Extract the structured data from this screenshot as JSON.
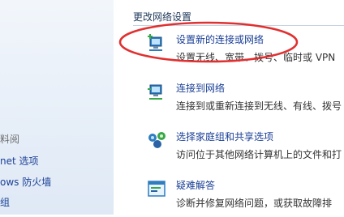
{
  "left_pane": {
    "see_also_fragment": "料阅",
    "links": [
      {
        "label": "net 选项"
      },
      {
        "label": "ows 防火墙"
      },
      {
        "label": "组"
      }
    ]
  },
  "main": {
    "section_title": "更改网络设置",
    "tasks": [
      {
        "title": "设置新的连接或网络",
        "description": "设置无线、宽带、拨号、临时或 VPN",
        "icon": "network-setup-icon"
      },
      {
        "title": "连接到网络",
        "description": "连接到或重新连接到无线、有线、拨号",
        "icon": "connect-network-icon"
      },
      {
        "title": "选择家庭组和共享选项",
        "description": "访问位于其他网络计算机上的文件和打",
        "icon": "homegroup-icon"
      },
      {
        "title": "疑难解答",
        "description": "诊断并修复网络问题，或获取故障排",
        "icon": "troubleshoot-icon"
      }
    ]
  },
  "annotation": {
    "color": "#e03030"
  }
}
